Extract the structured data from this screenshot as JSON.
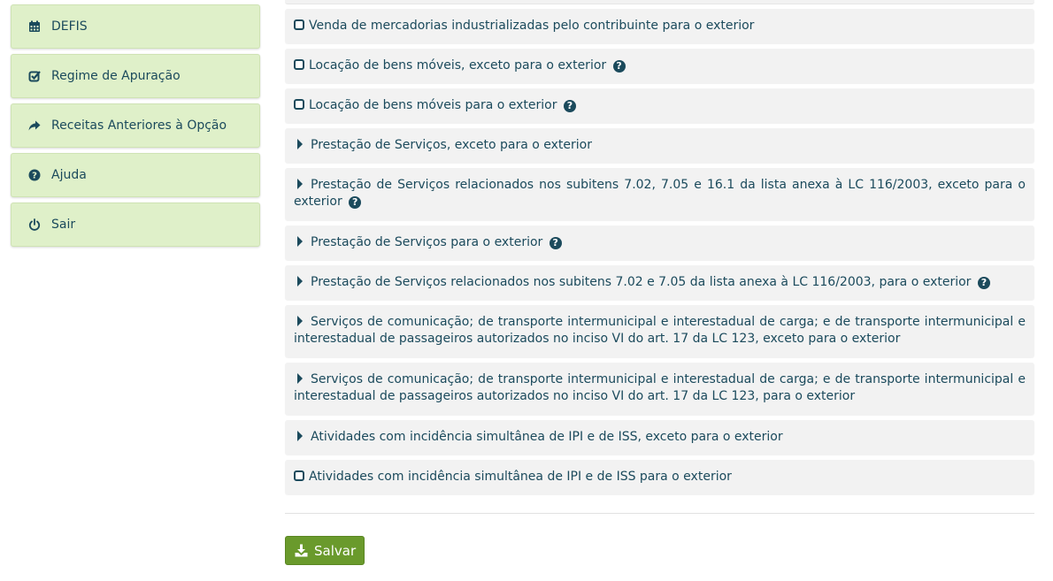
{
  "sidebar": {
    "items": [
      {
        "label": "DEFIS",
        "icon": "calendar-icon"
      },
      {
        "label": "Regime de Apuração",
        "icon": "check-square-icon"
      },
      {
        "label": "Receitas Anteriores à Opção",
        "icon": "share-arrow-icon"
      },
      {
        "label": "Ajuda",
        "icon": "question-circle-icon"
      },
      {
        "label": "Sair",
        "icon": "power-icon"
      }
    ]
  },
  "activities": [
    {
      "type": "checkbox",
      "text": "Venda de mercadorias industrializadas pelo contribuinte para o exterior",
      "help": false
    },
    {
      "type": "checkbox",
      "text": "Locação de bens móveis, exceto para o exterior",
      "help": true
    },
    {
      "type": "checkbox",
      "text": "Locação de bens móveis para o exterior",
      "help": true
    },
    {
      "type": "expand",
      "text": "Prestação de Serviços, exceto para o exterior",
      "help": false
    },
    {
      "type": "expand",
      "text": "Prestação de Serviços relacionados nos subitens 7.02, 7.05 e 16.1 da lista anexa à LC 116/2003, exceto para o exterior",
      "help": true
    },
    {
      "type": "expand",
      "text": "Prestação de Serviços para o exterior",
      "help": true
    },
    {
      "type": "expand",
      "text": "Prestação de Serviços relacionados nos subitens 7.02 e 7.05 da lista anexa à LC 116/2003, para o exterior",
      "help": true
    },
    {
      "type": "expand",
      "text": "Serviços de comunicação; de transporte intermunicipal e interestadual de carga; e de transporte intermunicipal e interestadual de passageiros autorizados no inciso VI do art. 17 da LC 123, exceto para o exterior",
      "help": false
    },
    {
      "type": "expand",
      "text": "Serviços de comunicação; de transporte intermunicipal e interestadual de carga; e de transporte intermunicipal e interestadual de passageiros autorizados no inciso VI do art. 17 da LC 123, para o exterior",
      "help": false
    },
    {
      "type": "expand",
      "text": "Atividades com incidência simultânea de IPI e de ISS, exceto para o exterior",
      "help": false
    },
    {
      "type": "checkbox",
      "text": "Atividades com incidência simultânea de IPI e de ISS para o exterior",
      "help": false
    }
  ],
  "help_glyph": "?",
  "save_button": {
    "label": "Salvar",
    "icon": "download-icon"
  },
  "colors": {
    "sidebar_bg": "#dff0c9",
    "text": "#1b4a5c",
    "row_bg": "#f2f2f2",
    "save_bg": "#6a9a2c"
  }
}
